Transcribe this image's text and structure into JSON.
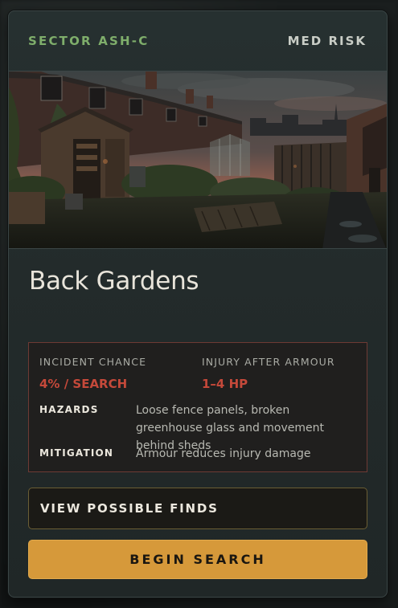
{
  "card": {
    "sector": "SECTOR ASH-C",
    "risk": "MED RISK",
    "location_title": "Back Gardens"
  },
  "stats": {
    "incident_label": "INCIDENT CHANCE",
    "incident_value": "4% / SEARCH",
    "injury_label": "INJURY AFTER ARMOUR",
    "injury_value": "1–4 HP"
  },
  "details": {
    "hazards_label": "HAZARDS",
    "hazards_text": "Loose fence panels, broken greenhouse glass and movement behind sheds",
    "mitigation_label": "MITIGATION",
    "mitigation_text": "Armour reduces injury damage"
  },
  "actions": {
    "view_finds_label": "VIEW POSSIBLE FINDS",
    "begin_search_label": "BEGIN SEARCH"
  },
  "colors": {
    "sector_accent": "#7fae6b",
    "danger_value": "#c5493a",
    "primary_button": "#d6993a"
  }
}
